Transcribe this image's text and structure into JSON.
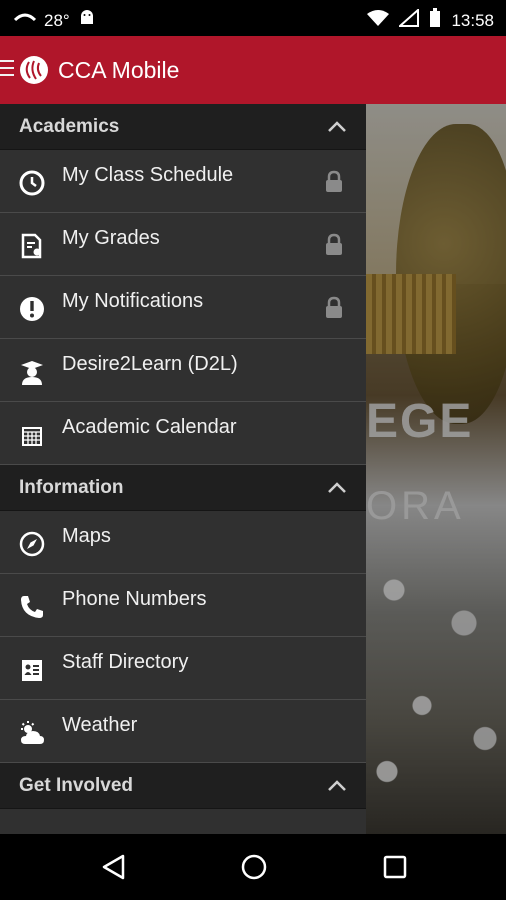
{
  "status_bar": {
    "temperature": "28°",
    "time": "13:58"
  },
  "app_bar": {
    "title": "CCA Mobile"
  },
  "drawer": {
    "sections": [
      {
        "title": "Academics",
        "items": [
          {
            "label": "My Class Schedule",
            "icon": "clock-icon",
            "locked": true
          },
          {
            "label": "My Grades",
            "icon": "grades-document-icon",
            "locked": true
          },
          {
            "label": "My Notifications",
            "icon": "alert-icon",
            "locked": true
          },
          {
            "label": "Desire2Learn (D2L)",
            "icon": "graduate-icon",
            "locked": false
          },
          {
            "label": "Academic Calendar",
            "icon": "calendar-icon",
            "locked": false
          }
        ]
      },
      {
        "title": "Information",
        "items": [
          {
            "label": "Maps",
            "icon": "compass-icon",
            "locked": false
          },
          {
            "label": "Phone Numbers",
            "icon": "phone-icon",
            "locked": false
          },
          {
            "label": "Staff Directory",
            "icon": "contact-card-icon",
            "locked": false
          },
          {
            "label": "Weather",
            "icon": "weather-icon",
            "locked": false
          }
        ]
      },
      {
        "title": "Get Involved",
        "items": []
      }
    ]
  },
  "background_image": {
    "sign_line_1": "EGE",
    "sign_line_2": "ORA"
  },
  "colors": {
    "app_bar": "#b0162a",
    "drawer_bg": "#2f2f2f",
    "section_header_bg": "#1f1f1f"
  }
}
